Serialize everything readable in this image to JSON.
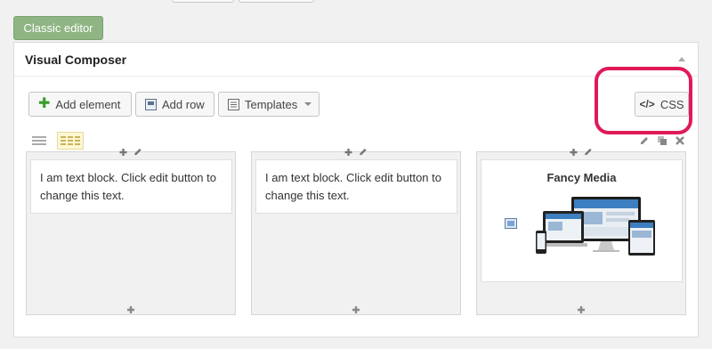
{
  "top_buttons": [
    "",
    ""
  ],
  "classic_editor_label": "Classic editor",
  "panel": {
    "title": "Visual Composer"
  },
  "toolbar": {
    "add_element_label": "Add element",
    "add_row_label": "Add row",
    "templates_label": "Templates",
    "css_label": "CSS"
  },
  "columns": [
    {
      "element_text": "I am text block. Click edit button to change this text."
    },
    {
      "element_text": "I am text block. Click edit button to change this text."
    },
    {
      "element_title": "Fancy Media"
    }
  ],
  "colors": {
    "accent_green": "#8fb584",
    "highlight_ring": "#e01a58",
    "add_icon_green": "#3a9c29"
  }
}
